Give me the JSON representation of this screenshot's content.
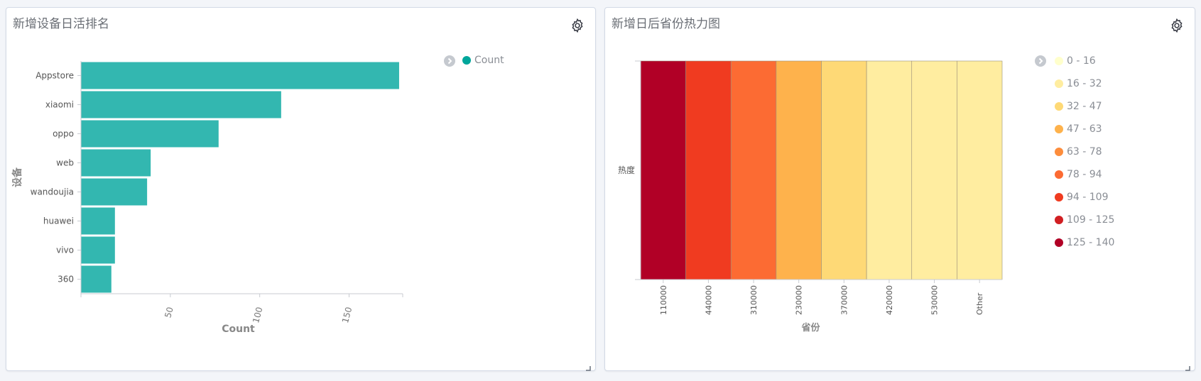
{
  "panels": [
    {
      "title": "新增设备日活排名"
    },
    {
      "title": "新增日后省份热力图"
    }
  ],
  "icons": {
    "settings": "gear-icon",
    "legend_toggle": "chevron-right-icon",
    "resize": "resize-corner-icon"
  },
  "chart_data": [
    {
      "type": "bar",
      "orientation": "horizontal",
      "categories": [
        "Appstore",
        "xiaomi",
        "oppo",
        "web",
        "wandoujia",
        "huawei",
        "vivo",
        "360"
      ],
      "values": [
        178,
        112,
        77,
        39,
        37,
        19,
        19,
        17
      ],
      "xlabel": "Count",
      "ylabel": "设备",
      "xticks": [
        "50",
        "100",
        "150"
      ],
      "xlim": [
        0,
        180
      ],
      "color": "#33b7b0",
      "legend": {
        "position": "right",
        "entries": [
          "Count"
        ],
        "color": "#00a69b"
      }
    },
    {
      "type": "heatmap",
      "categories": [
        "110000",
        "440000",
        "310000",
        "230000",
        "370000",
        "420000",
        "530000",
        "Other"
      ],
      "rows": [
        "热度"
      ],
      "values": [
        140,
        100,
        85,
        55,
        40,
        25,
        25,
        25
      ],
      "xlabel": "省份",
      "legend": {
        "position": "right",
        "entries": [
          {
            "label": "0 - 16",
            "color": "#ffffcc"
          },
          {
            "label": "16 - 32",
            "color": "#ffeda0"
          },
          {
            "label": "32 - 47",
            "color": "#fed976"
          },
          {
            "label": "47 - 63",
            "color": "#feb24c"
          },
          {
            "label": "63 - 78",
            "color": "#fd8d3c"
          },
          {
            "label": "78 - 94",
            "color": "#fc6b33"
          },
          {
            "label": "94 - 109",
            "color": "#f03b20"
          },
          {
            "label": "109 - 125",
            "color": "#d11f22"
          },
          {
            "label": "125 - 140",
            "color": "#b10026"
          }
        ]
      }
    }
  ]
}
